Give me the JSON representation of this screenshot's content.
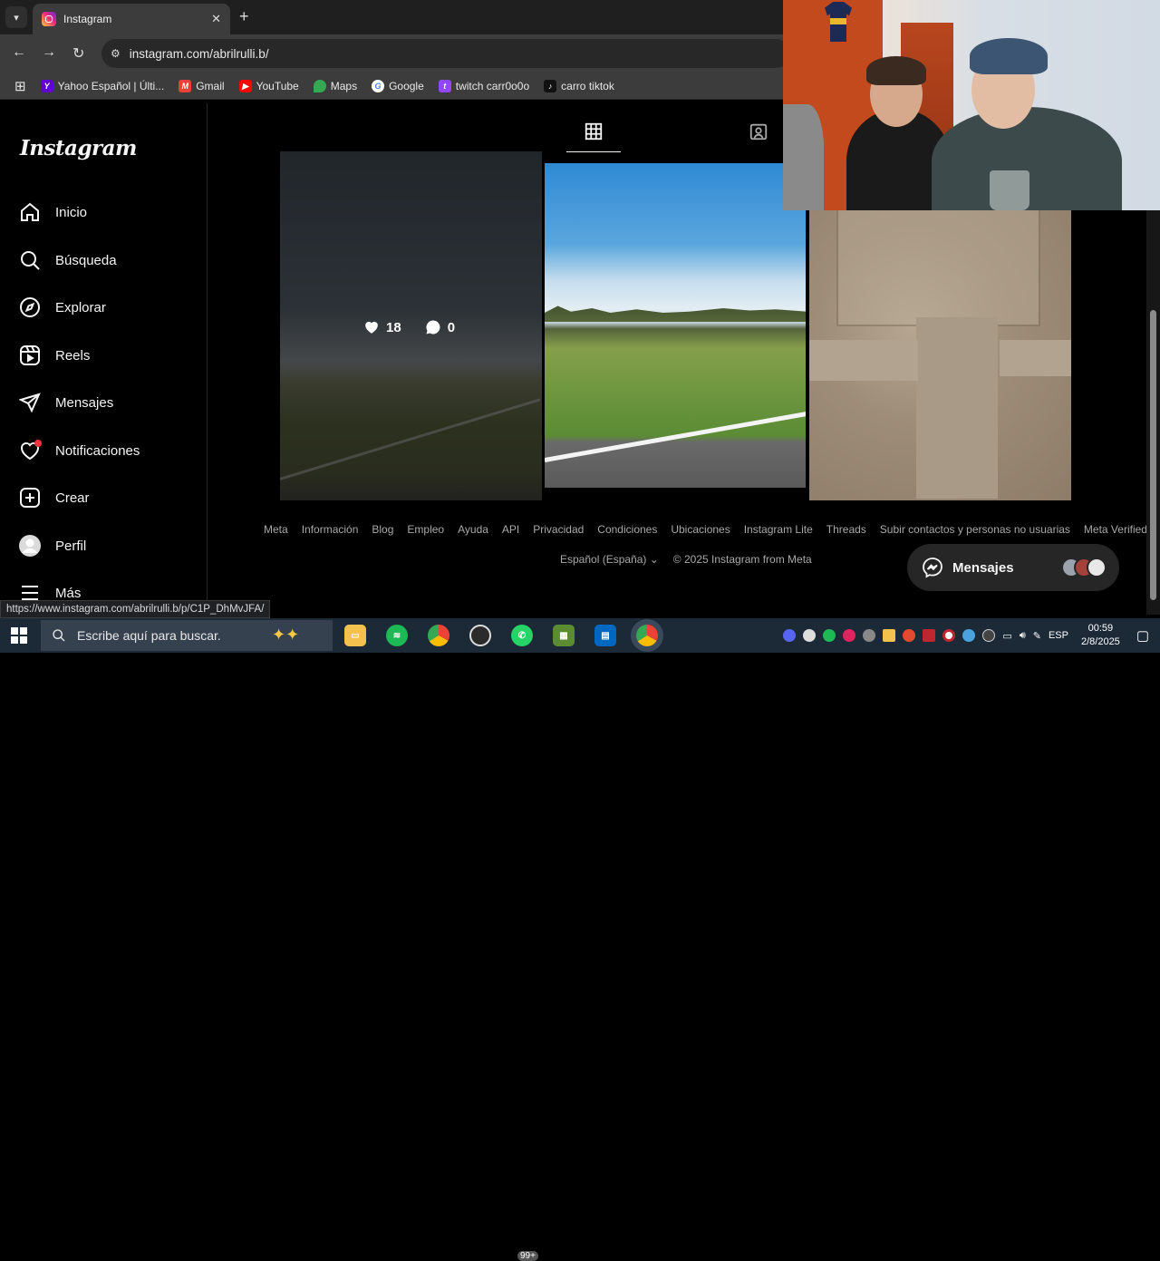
{
  "browser": {
    "tab_title": "Instagram",
    "url": "instagram.com/abrilrulli.b/",
    "bookmarks": [
      {
        "label": "Yahoo Español | Últi...",
        "color": "#6001d2",
        "glyph": "Y"
      },
      {
        "label": "Gmail",
        "color": "#ea4335",
        "glyph": "M"
      },
      {
        "label": "YouTube",
        "color": "#ff0000",
        "glyph": "▶"
      },
      {
        "label": "Maps",
        "color": "#34a853",
        "glyph": "●"
      },
      {
        "label": "Google",
        "color": "#4285f4",
        "glyph": "G"
      },
      {
        "label": "twitch carr0o0o",
        "color": "#9146ff",
        "glyph": "t"
      },
      {
        "label": "carro tiktok",
        "color": "#111111",
        "glyph": "♪"
      }
    ],
    "status_url": "https://www.instagram.com/abrilrulli.b/p/C1P_DhMvJFA/"
  },
  "sidebar": {
    "logo": "Instagram",
    "items": [
      {
        "label": "Inicio",
        "icon": "home-icon"
      },
      {
        "label": "Búsqueda",
        "icon": "search-icon"
      },
      {
        "label": "Explorar",
        "icon": "compass-icon"
      },
      {
        "label": "Reels",
        "icon": "reels-icon"
      },
      {
        "label": "Mensajes",
        "icon": "send-icon"
      },
      {
        "label": "Notificaciones",
        "icon": "heart-icon"
      },
      {
        "label": "Crear",
        "icon": "plus-square-icon"
      },
      {
        "label": "Perfil",
        "icon": "avatar-icon"
      },
      {
        "label": "Más",
        "icon": "hamburger-icon"
      }
    ]
  },
  "profile": {
    "hovered_post": {
      "likes": "18",
      "comments": "0"
    }
  },
  "footer": {
    "links": [
      "Meta",
      "Información",
      "Blog",
      "Empleo",
      "Ayuda",
      "API",
      "Privacidad",
      "Condiciones",
      "Ubicaciones",
      "Instagram Lite",
      "Threads",
      "Subir contactos y personas no usuarias",
      "Meta Verified"
    ],
    "language": "Español (España)",
    "copyright": "© 2025 Instagram from Meta"
  },
  "messages_pill": {
    "label": "Mensajes"
  },
  "taskbar": {
    "search_placeholder": "Escribe aquí para buscar.",
    "badge": "99+",
    "language": "ESP",
    "time": "00:59",
    "date": "2/8/2025"
  },
  "colors": {
    "notification_dot": "#ff3040",
    "accent": "#0095f6"
  }
}
